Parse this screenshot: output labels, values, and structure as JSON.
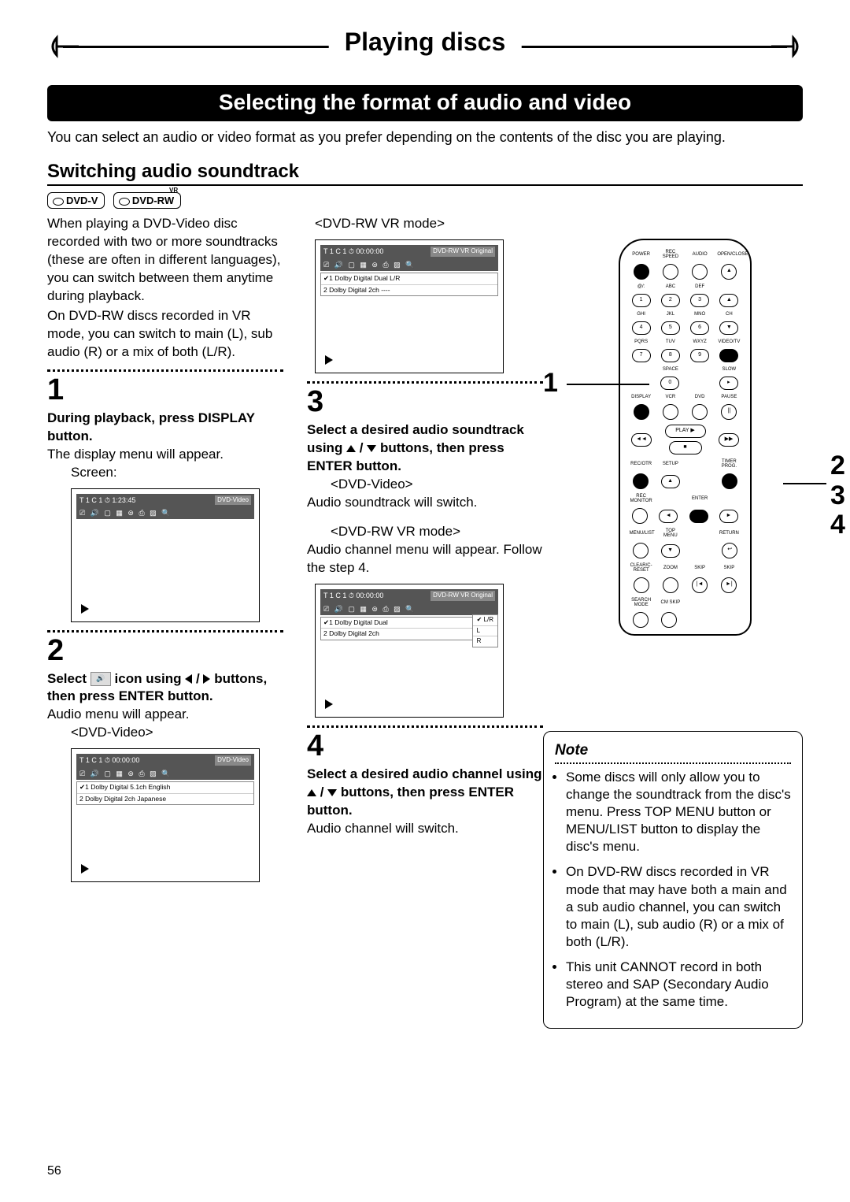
{
  "page_number": "56",
  "header": {
    "title": "Playing discs",
    "subtitle": "Selecting the format of audio and video"
  },
  "intro": "You can select an audio or video format as you prefer depending on the contents of the disc you are playing.",
  "section_title": "Switching audio soundtrack",
  "badges": {
    "dvdv": "DVD-V",
    "dvdrw": "DVD-RW",
    "vr": "VR"
  },
  "left": {
    "para1": "When playing a DVD-Video disc recorded with two or more soundtracks (these are often in different languages), you can switch between them anytime during playback.",
    "para2": "On DVD-RW discs recorded in VR mode, you can switch to main (L), sub audio (R) or a mix of both (L/R).",
    "step1": {
      "num": "1",
      "bold": "During playback, press DISPLAY button.",
      "text": "The display menu will appear.",
      "screen_label": "Screen:",
      "screen": {
        "header": "T    1   C    1 ⏱   1:23:45",
        "tag": "DVD-Video",
        "icons": "⎚ 🔊 ▢ ▦ ⊜ ⎙ ▨ 🔍"
      }
    },
    "step2": {
      "num": "2",
      "bold_pre": "Select ",
      "bold_post": " icon using ",
      "bold_end": " buttons, then press ENTER button.",
      "text": "Audio menu will appear.",
      "mode": "<DVD-Video>",
      "screen": {
        "header": "T    1   C    1 ⏱   00:00:00",
        "tag": "DVD-Video",
        "icons": "⎚ 🔊 ▢ ▦ ⊜ ⎙ ▨ 🔍",
        "row1": "✔1 Dolby Digital  5.1ch  English",
        "row2": "   2 Dolby Digital   2ch   Japanese"
      }
    }
  },
  "mid": {
    "mode_vr": "<DVD-RW VR mode>",
    "screen_vr1": {
      "header": "T    1   C    1 ⏱   00:00:00",
      "tag": "DVD-RW VR Original",
      "icons": "⎚ 🔊 ▢ ▦ ⊜ ⎙ ▨ 🔍",
      "row1": "✔1 Dolby Digital   Dual  L/R",
      "row2": "   2 Dolby Digital    2ch   ----"
    },
    "step3": {
      "num": "3",
      "bold": "Select a desired audio soundtrack using ▲ / ▼ buttons, then press ENTER button.",
      "mode_video": "<DVD-Video>",
      "text_video": "Audio soundtrack will switch.",
      "mode_vr": "<DVD-RW VR mode>",
      "text_vr": "Audio channel menu will appear. Follow the step 4.",
      "screen": {
        "header": "T    1   C    1 ⏱   00:00:00",
        "tag": "DVD-RW VR Original",
        "icons": "⎚ 🔊 ▢ ▦ ⊜ ⎙ ▨ 🔍",
        "row1": "✔1 Dolby Digital   Dual",
        "row2": "   2 Dolby Digital    2ch",
        "lr1": "✔ L/R",
        "lr2": "L",
        "lr3": "R"
      }
    },
    "step4": {
      "num": "4",
      "bold": "Select a desired audio channel using ▲ / ▼ buttons, then press ENTER button.",
      "text": "Audio channel will switch."
    }
  },
  "callouts": {
    "c1": "1",
    "c234": "2\n3\n4"
  },
  "note": {
    "title": "Note",
    "items": [
      "Some discs will only allow you to change the soundtrack from the disc's menu. Press TOP MENU button or MENU/LIST button to display the disc's menu.",
      "On DVD-RW discs recorded in VR mode that may have both a main and a sub audio channel, you can switch to main (L), sub audio (R) or a mix of both (L/R).",
      "This unit CANNOT record in both stereo and SAP (Secondary Audio Program) at the same time."
    ]
  },
  "remote": {
    "row1": [
      "POWER",
      "REC SPEED",
      "AUDIO",
      "OPEN/CLOSE"
    ],
    "row2_labels": [
      "@/:",
      "ABC",
      "DEF",
      ""
    ],
    "row2": [
      "1",
      "2",
      "3",
      "▲"
    ],
    "row3_labels": [
      "GHI",
      "JKL",
      "MNO",
      "CH"
    ],
    "row3": [
      "4",
      "5",
      "6",
      "▼"
    ],
    "row4_labels": [
      "PQRS",
      "TUV",
      "WXYZ",
      "VIDEO/TV"
    ],
    "row4": [
      "7",
      "8",
      "9",
      "●"
    ],
    "row5_labels": [
      "",
      "SPACE",
      "",
      "SLOW"
    ],
    "row5": [
      "",
      "0",
      "",
      "▸"
    ],
    "row6_labels": [
      "DISPLAY",
      "VCR",
      "DVD",
      "PAUSE"
    ],
    "row6": [
      "●",
      "⊙",
      "⊙",
      "||"
    ],
    "play": "PLAY ▶",
    "stop": "STOP ■",
    "nav_l": "◄◄",
    "nav_r": "▶▶",
    "row7_labels": [
      "REC/OTR",
      "SETUP",
      "",
      "TIMER PROG."
    ],
    "row8_labels": [
      "REC MONITOR",
      "",
      "ENTER",
      ""
    ],
    "row9_labels": [
      "MENU/LIST",
      "TOP MENU",
      "",
      "RETURN"
    ],
    "row10_labels": [
      "CLEAR/C-RESET",
      "ZOOM",
      "SKIP",
      "SKIP"
    ],
    "row11_labels": [
      "SEARCH MODE",
      "CM SKIP",
      "",
      ""
    ]
  }
}
